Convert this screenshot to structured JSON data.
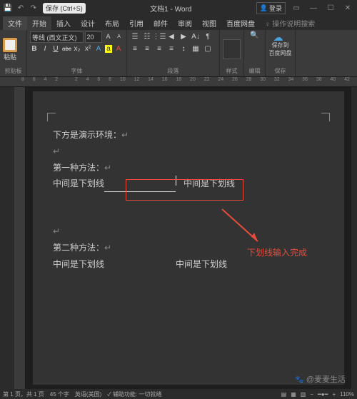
{
  "titlebar": {
    "save_shortcut": "保存 (Ctrl+S)",
    "title": "文档1 - Word",
    "account": "登录"
  },
  "tabs": {
    "file": "文件",
    "home": "开始",
    "insert": "插入",
    "design": "设计",
    "layout": "布局",
    "refs": "引用",
    "mail": "邮件",
    "review": "审阅",
    "view": "视图",
    "netdisk": "百度网盘",
    "tellme": "操作说明搜索"
  },
  "ribbon": {
    "paste": "粘贴",
    "clipboard": "剪贴板",
    "font_name": "等线 (西文正文)",
    "font_size": "20",
    "B": "B",
    "I": "I",
    "U": "U",
    "abc": "abc",
    "x2": "x₂",
    "X2": "x²",
    "A1": "A",
    "A2": "A",
    "font_label": "字体",
    "para_label": "段落",
    "style_label": "样式",
    "edit": "编辑",
    "save_to": "保存到",
    "baidu": "百度网盘",
    "save_label": "保存"
  },
  "ruler_marks": [
    "8",
    "6",
    "4",
    "2",
    "",
    "2",
    "4",
    "6",
    "8",
    "10",
    "12",
    "14",
    "16",
    "18",
    "20",
    "22",
    "24",
    "26",
    "28",
    "30",
    "32",
    "34",
    "36",
    "38",
    "40",
    "42"
  ],
  "doc": {
    "line1": "下方是演示环境：",
    "method1": "第一种方法：",
    "line2a": "中间是下划线",
    "line2b": "中间是下划线",
    "method2": "第二种方法：",
    "line3a": "中间是下划线",
    "line3b": "中间是下划线"
  },
  "annotation": "下划线输入完成",
  "status": {
    "page": "第 1 页，共 1 页",
    "words": "45 个字",
    "lang": "英语(美国)",
    "assist": "辅助功能: 一切就绪",
    "zoom": "110%"
  },
  "watermark": "@麦麦生活"
}
